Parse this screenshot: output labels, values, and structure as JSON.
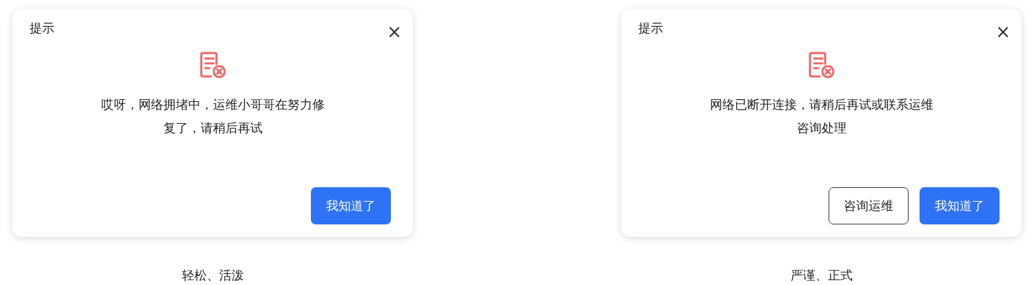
{
  "panels": [
    {
      "dialog": {
        "title": "提示",
        "close": "×",
        "message_lines": [
          "哎呀，网络拥堵中，运维小哥哥在努力修",
          "复了，请稍后再试"
        ],
        "buttons": [
          {
            "label": "我知道了",
            "kind": "primary"
          }
        ]
      },
      "caption": "轻松、活泼"
    },
    {
      "dialog": {
        "title": "提示",
        "close": "×",
        "message_lines": [
          "网络已断开连接，请稍后再试或联系运维",
          "咨询处理"
        ],
        "buttons": [
          {
            "label": "咨询运维",
            "kind": "outline"
          },
          {
            "label": "我知道了",
            "kind": "primary"
          }
        ]
      },
      "caption": "严谨、正式"
    }
  ]
}
